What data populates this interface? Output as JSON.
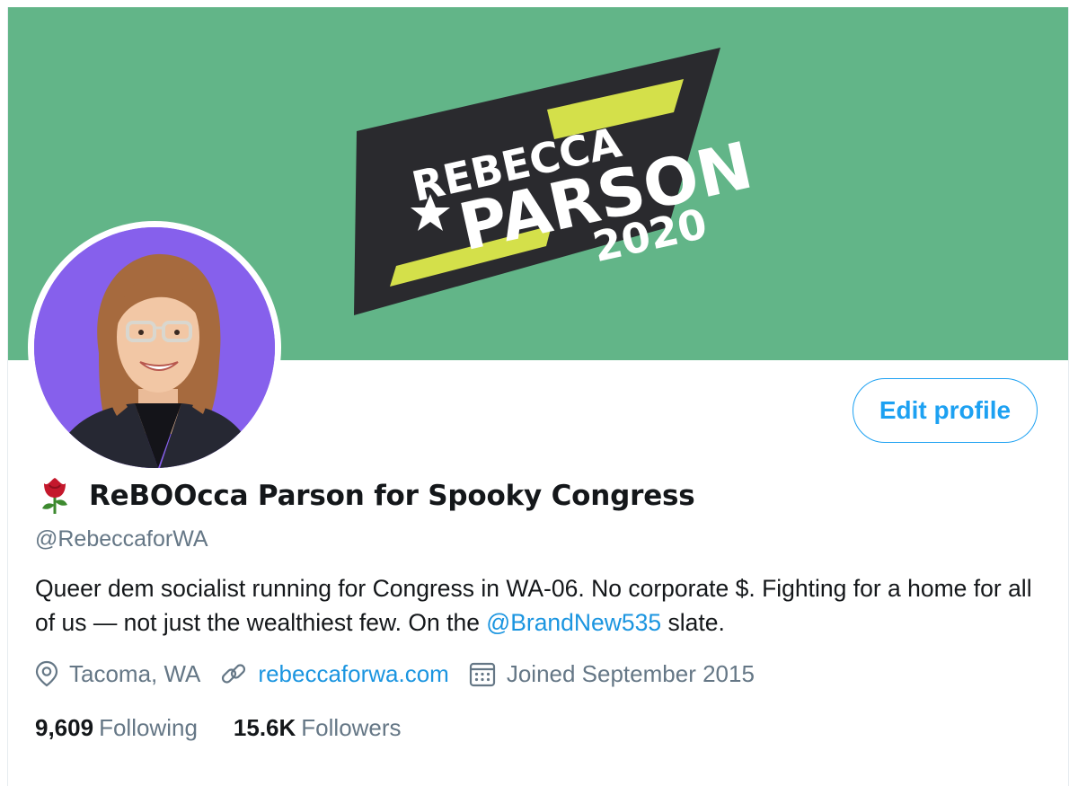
{
  "banner": {
    "logo_line1": "REBECCA",
    "logo_line2": "PARSON",
    "logo_year": "2020",
    "colors": {
      "background": "#62b588",
      "badge": "#2a2a2e",
      "stripe": "#d4e04a"
    }
  },
  "profile": {
    "display_name": "ReBOOcca Parson for Spooky Congress",
    "name_emoji_icon": "rose-icon",
    "handle": "@RebeccaforWA",
    "bio_before_mention": "Queer dem socialist running for Congress in WA-06. No corporate $. Fighting for a home for all of us — not just the wealthiest few. On the ",
    "bio_mention": "@BrandNew535",
    "bio_after_mention": " slate.",
    "location": "Tacoma, WA",
    "website": "rebeccaforwa.com",
    "joined": "Joined September 2015"
  },
  "actions": {
    "edit_profile_label": "Edit profile"
  },
  "stats": {
    "following_count": "9,609",
    "following_label": "Following",
    "followers_count": "15.6K",
    "followers_label": "Followers"
  },
  "icons": {
    "location": "location-pin-icon",
    "website": "link-icon",
    "joined": "calendar-icon"
  },
  "colors": {
    "accent": "#1da1f2",
    "link": "#1b95e0",
    "text_primary": "#14171a",
    "text_secondary": "#657786"
  }
}
